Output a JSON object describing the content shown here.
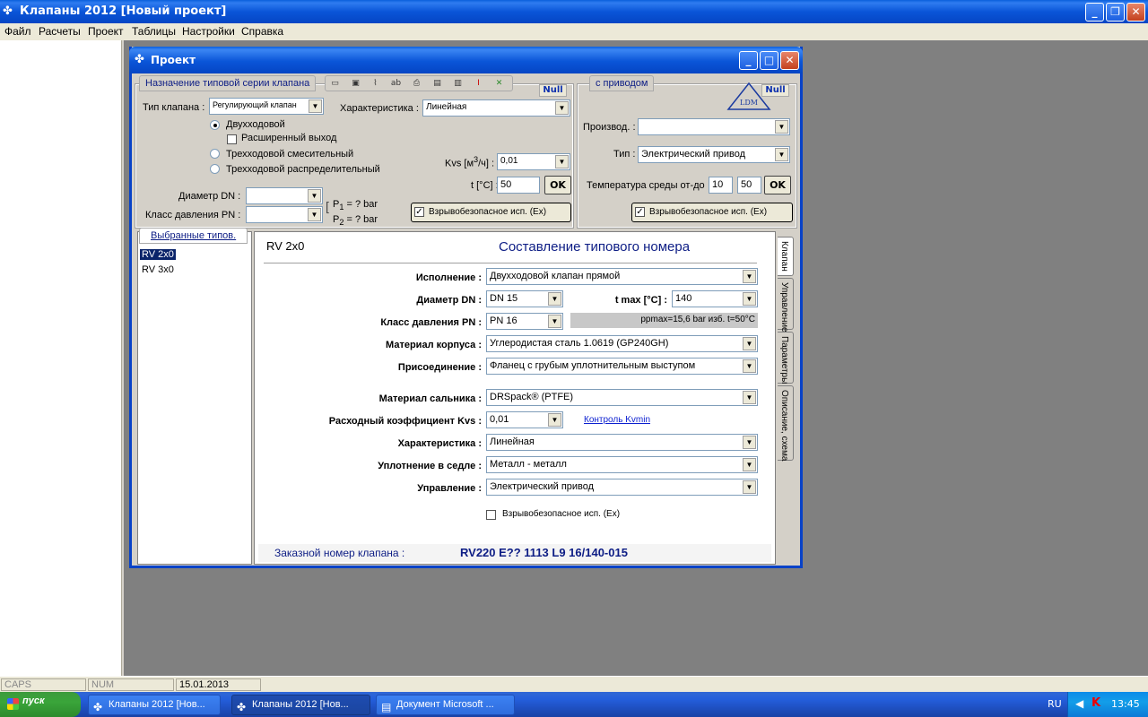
{
  "app": {
    "title": "Клапаны 2012 [Новый проект]"
  },
  "menu": [
    "Файл",
    "Расчеты",
    "Проект",
    "Таблицы",
    "Настройки",
    "Справка"
  ],
  "status": {
    "caps": "CAPS",
    "num": "NUM",
    "date": "15.01.2013"
  },
  "taskbar": {
    "start": "пуск",
    "tasks": [
      "Клапаны 2012 [Нов...",
      "Клапаны 2012 [Нов...",
      "Документ Microsoft ..."
    ],
    "lang": "RU",
    "time": "13:45"
  },
  "project": {
    "title": "Проект",
    "series_tab": "Назначение типовой серии клапана",
    "drive_tab": "с приводом",
    "null_label": "Null",
    "logo_text": "LDM",
    "valve_type_label": "Тип клапана :",
    "valve_type_value": "Регулирующий клапан",
    "characteristic_label": "Характеристика :",
    "characteristic_value": "Линейная",
    "radio_two_way": "Двухходовой",
    "extended_outlet": "Расширенный выход",
    "radio_three_mix": "Трехходовой смесительный",
    "radio_three_dist": "Трехходовой распределительный",
    "kvs_label_pre": "Kvs [м",
    "kvs_label_sup": "3",
    "kvs_label_post": "/ч] :",
    "kvs_value": "0,01",
    "t_label": "t [°C] :",
    "t_value": "50",
    "ok": "OK",
    "dn_label": "Диаметр DN :",
    "pn_label": "Класс давления PN :",
    "p1": "P",
    "p1_sub": "1",
    "p1_tail": " = ? bar",
    "p2": "P",
    "p2_sub": "2",
    "p2_tail": " = ? bar",
    "ex_label": "Взрывобезопасное исп. (Ex)",
    "manuf_label": "Производ. :",
    "type_label": "Тип :",
    "type_value": "Электрический привод",
    "temp_label": "Температура среды от-до",
    "temp_from": "10",
    "temp_to": "50",
    "drive_ex_label": "Взрывобезопасное исп. (Ex)"
  },
  "selected": {
    "tab": "Выбранные типов.",
    "items": [
      "RV 2x0",
      "RV 3x0"
    ]
  },
  "compose": {
    "code": "RV 2x0",
    "heading": "Составление типового номера",
    "execution_label": "Исполнение :",
    "execution_value": "Двухходовой клапан прямой",
    "dn_label": "Диаметр DN :",
    "dn_value": "DN 15",
    "tmax_label": "t max [°C] :",
    "tmax_value": "140",
    "pn_label": "Класс давления PN :",
    "pn_value": "PN 16",
    "ppmax": "ppmax=15,6 bar изб. t=50°C",
    "body_label": "Материал корпуса :",
    "body_value": "Углеродистая сталь 1.0619 (GP240GH)",
    "conn_label": "Присоединение :",
    "conn_value": "Фланец с грубым уплотнительным выступом",
    "gland_label": "Материал сальника :",
    "gland_value": "DRSpack® (PTFE)",
    "kvs_label": "Расходный коэффициент Kvs :",
    "kvs_value": "0,01",
    "kvmin_link": "Контроль Kvmin",
    "char_label": "Характеристика :",
    "char_value": "Линейная",
    "seat_label": "Уплотнение в седле :",
    "seat_value": "Металл - металл",
    "control_label": "Управление :",
    "control_value": "Электрический привод",
    "ex_label": "Взрывобезопасное исп. (Ex)",
    "order_label": "Заказной номер клапана :",
    "order_value": "RV220 E?? 1113 L9 16/140-015"
  },
  "vtabs": [
    "Клапан",
    "Управление",
    "Параметры",
    "Описание, схема"
  ],
  "colors": {
    "title_blue": "#0a55d8",
    "link": "#0b1fd0",
    "order_number": "#0d1d85"
  }
}
